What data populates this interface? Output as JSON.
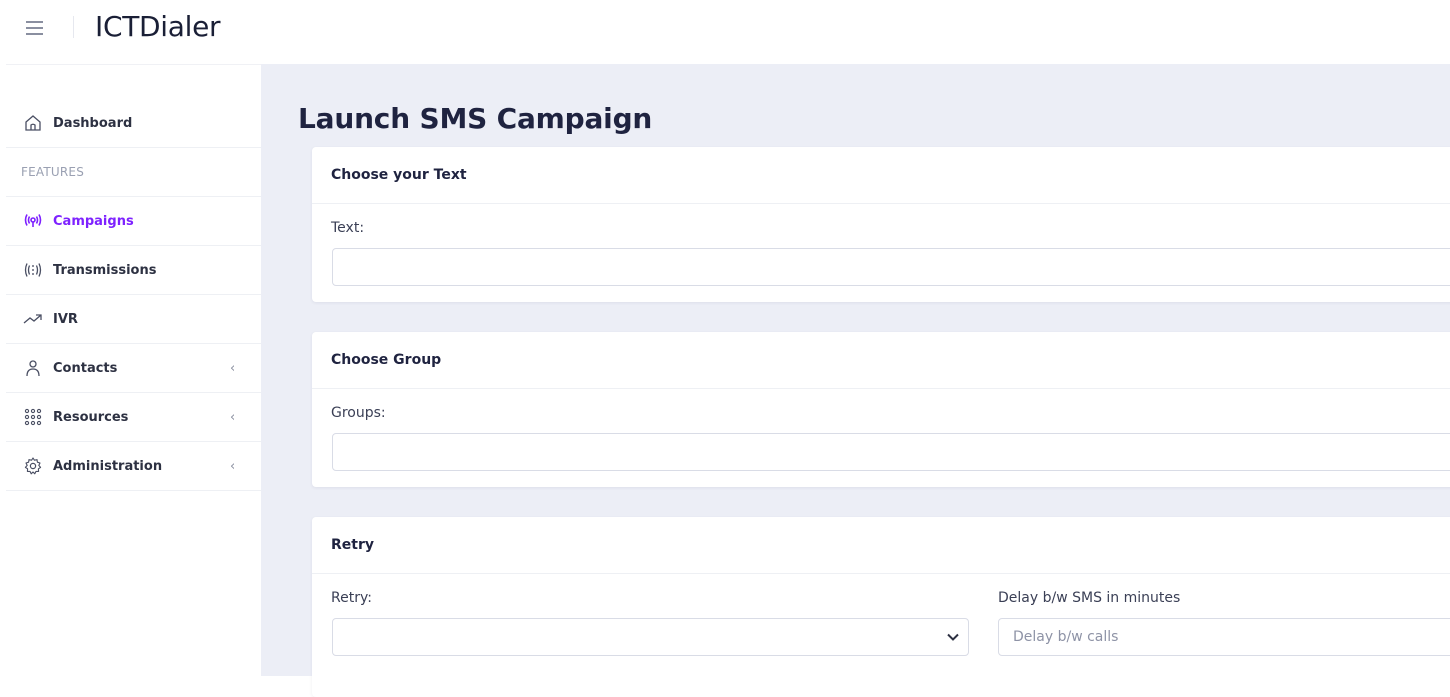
{
  "app": {
    "title": "ICTDialer"
  },
  "sidebar": {
    "items": [
      {
        "label": "Dashboard",
        "icon": "home-icon"
      },
      {
        "label": "FEATURES",
        "type": "section"
      },
      {
        "label": "Campaigns",
        "icon": "broadcast-icon",
        "active": true
      },
      {
        "label": "Transmissions",
        "icon": "signal-icon"
      },
      {
        "label": "IVR",
        "icon": "trending-up-icon"
      },
      {
        "label": "Contacts",
        "icon": "user-icon",
        "chevron": "‹"
      },
      {
        "label": "Resources",
        "icon": "grid-icon",
        "chevron": "‹"
      },
      {
        "label": "Administration",
        "icon": "gear-icon",
        "chevron": "‹"
      }
    ]
  },
  "page": {
    "title": "Launch SMS Campaign"
  },
  "cards": {
    "text": {
      "header": "Choose your Text",
      "label": "Text:",
      "value": ""
    },
    "group": {
      "header": "Choose Group",
      "label": "Groups:",
      "value": ""
    },
    "retry": {
      "header": "Retry",
      "retry_label": "Retry:",
      "retry_value": "",
      "delay_label": "Delay b/w SMS in minutes",
      "delay_placeholder": "Delay b/w calls"
    }
  },
  "colors": {
    "accent": "#7e22ff",
    "main_bg": "#eceef6"
  }
}
